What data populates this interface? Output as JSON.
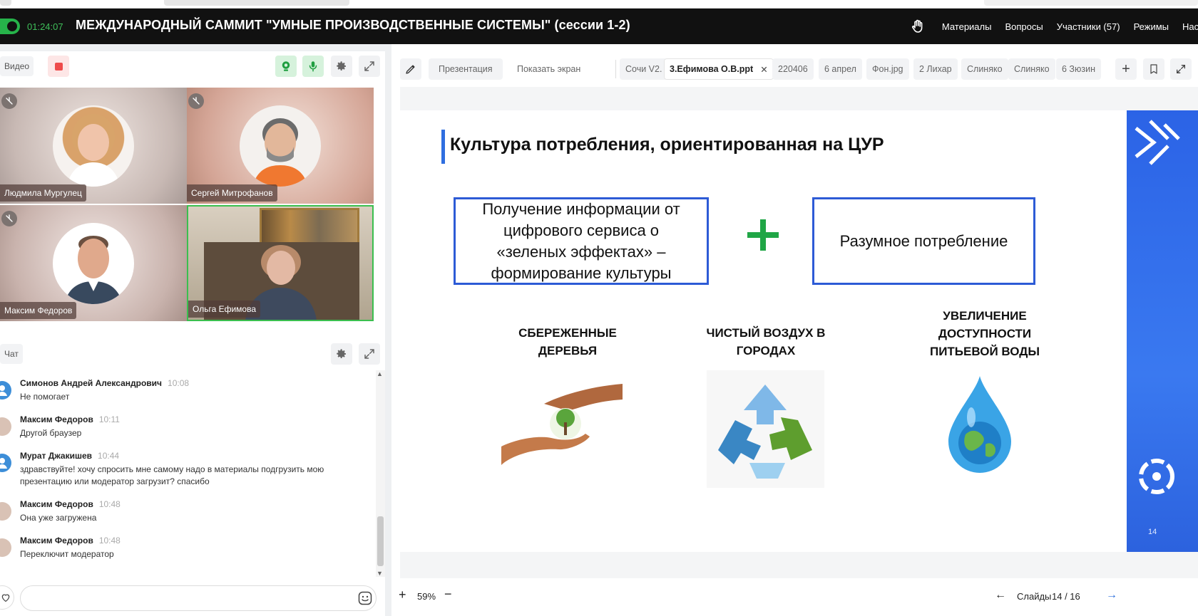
{
  "header": {
    "timer": "01:24:07",
    "title": "МЕЖДУНАРОДНЫЙ САММИТ \"УМНЫЕ ПРОИЗВОДСТВЕННЫЕ СИСТЕМЫ\" (сессии 1-2)",
    "nav": [
      "Материалы",
      "Вопросы",
      "Участники (57)",
      "Режимы",
      "Нас"
    ]
  },
  "video": {
    "label": "Видео",
    "participants": [
      {
        "name": "Людмила Мургулец",
        "muted": true
      },
      {
        "name": "Сергей Митрофанов",
        "muted": true
      },
      {
        "name": "Максим Федоров",
        "muted": true
      },
      {
        "name": "Ольга Ефимова",
        "muted": false,
        "speaking": true
      }
    ]
  },
  "chat": {
    "label": "Чат",
    "messages": [
      {
        "author": "Симонов Андрей Александрович",
        "time": "10:08",
        "text": "Не помогает"
      },
      {
        "author": "Максим Федоров",
        "time": "10:11",
        "text": "Другой браузер"
      },
      {
        "author": "Мурат Джакишев",
        "time": "10:44",
        "text": "здравствуйте! хочу спросить мне самому надо в материалы подгрузить мою презентацию или модератор загрузит? спасибо"
      },
      {
        "author": "Максим Федоров",
        "time": "10:48",
        "text": "Она уже загружена"
      },
      {
        "author": "Максим Федоров",
        "time": "10:48",
        "text": "Переключит модератор"
      }
    ],
    "input_placeholder": ""
  },
  "toolbar": {
    "presentation_label": "Презентация",
    "share_screen_label": "Показать экран",
    "files": [
      "Сочи V2.",
      "3.Ефимова О.В.ppt",
      "220406",
      "6 апрел",
      "Фон.jpg",
      "2 Лихар",
      "Слиняко",
      "Слиняко",
      "6 Зюзин"
    ],
    "active_file_index": 1
  },
  "slide": {
    "title": "Культура потребления, ориентированная на ЦУР",
    "box_left": "Получение информации от цифрового сервиса о «зеленых эффектах» – формирование культуры",
    "box_right": "Разумное потребление",
    "captions": [
      "СБЕРЕЖЕННЫЕ ДЕРЕВЬЯ",
      "ЧИСТЫЙ ВОЗДУХ В ГОРОДАХ",
      "УВЕЛИЧЕНИЕ ДОСТУПНОСТИ ПИТЬЕВОЙ ВОДЫ"
    ],
    "page_number": "14",
    "accent_color": "#2d5bd6",
    "plus_color": "#20a646"
  },
  "footer": {
    "zoom": "59%",
    "slides_label": "Слайды",
    "slides_counter": "14 / 16"
  }
}
